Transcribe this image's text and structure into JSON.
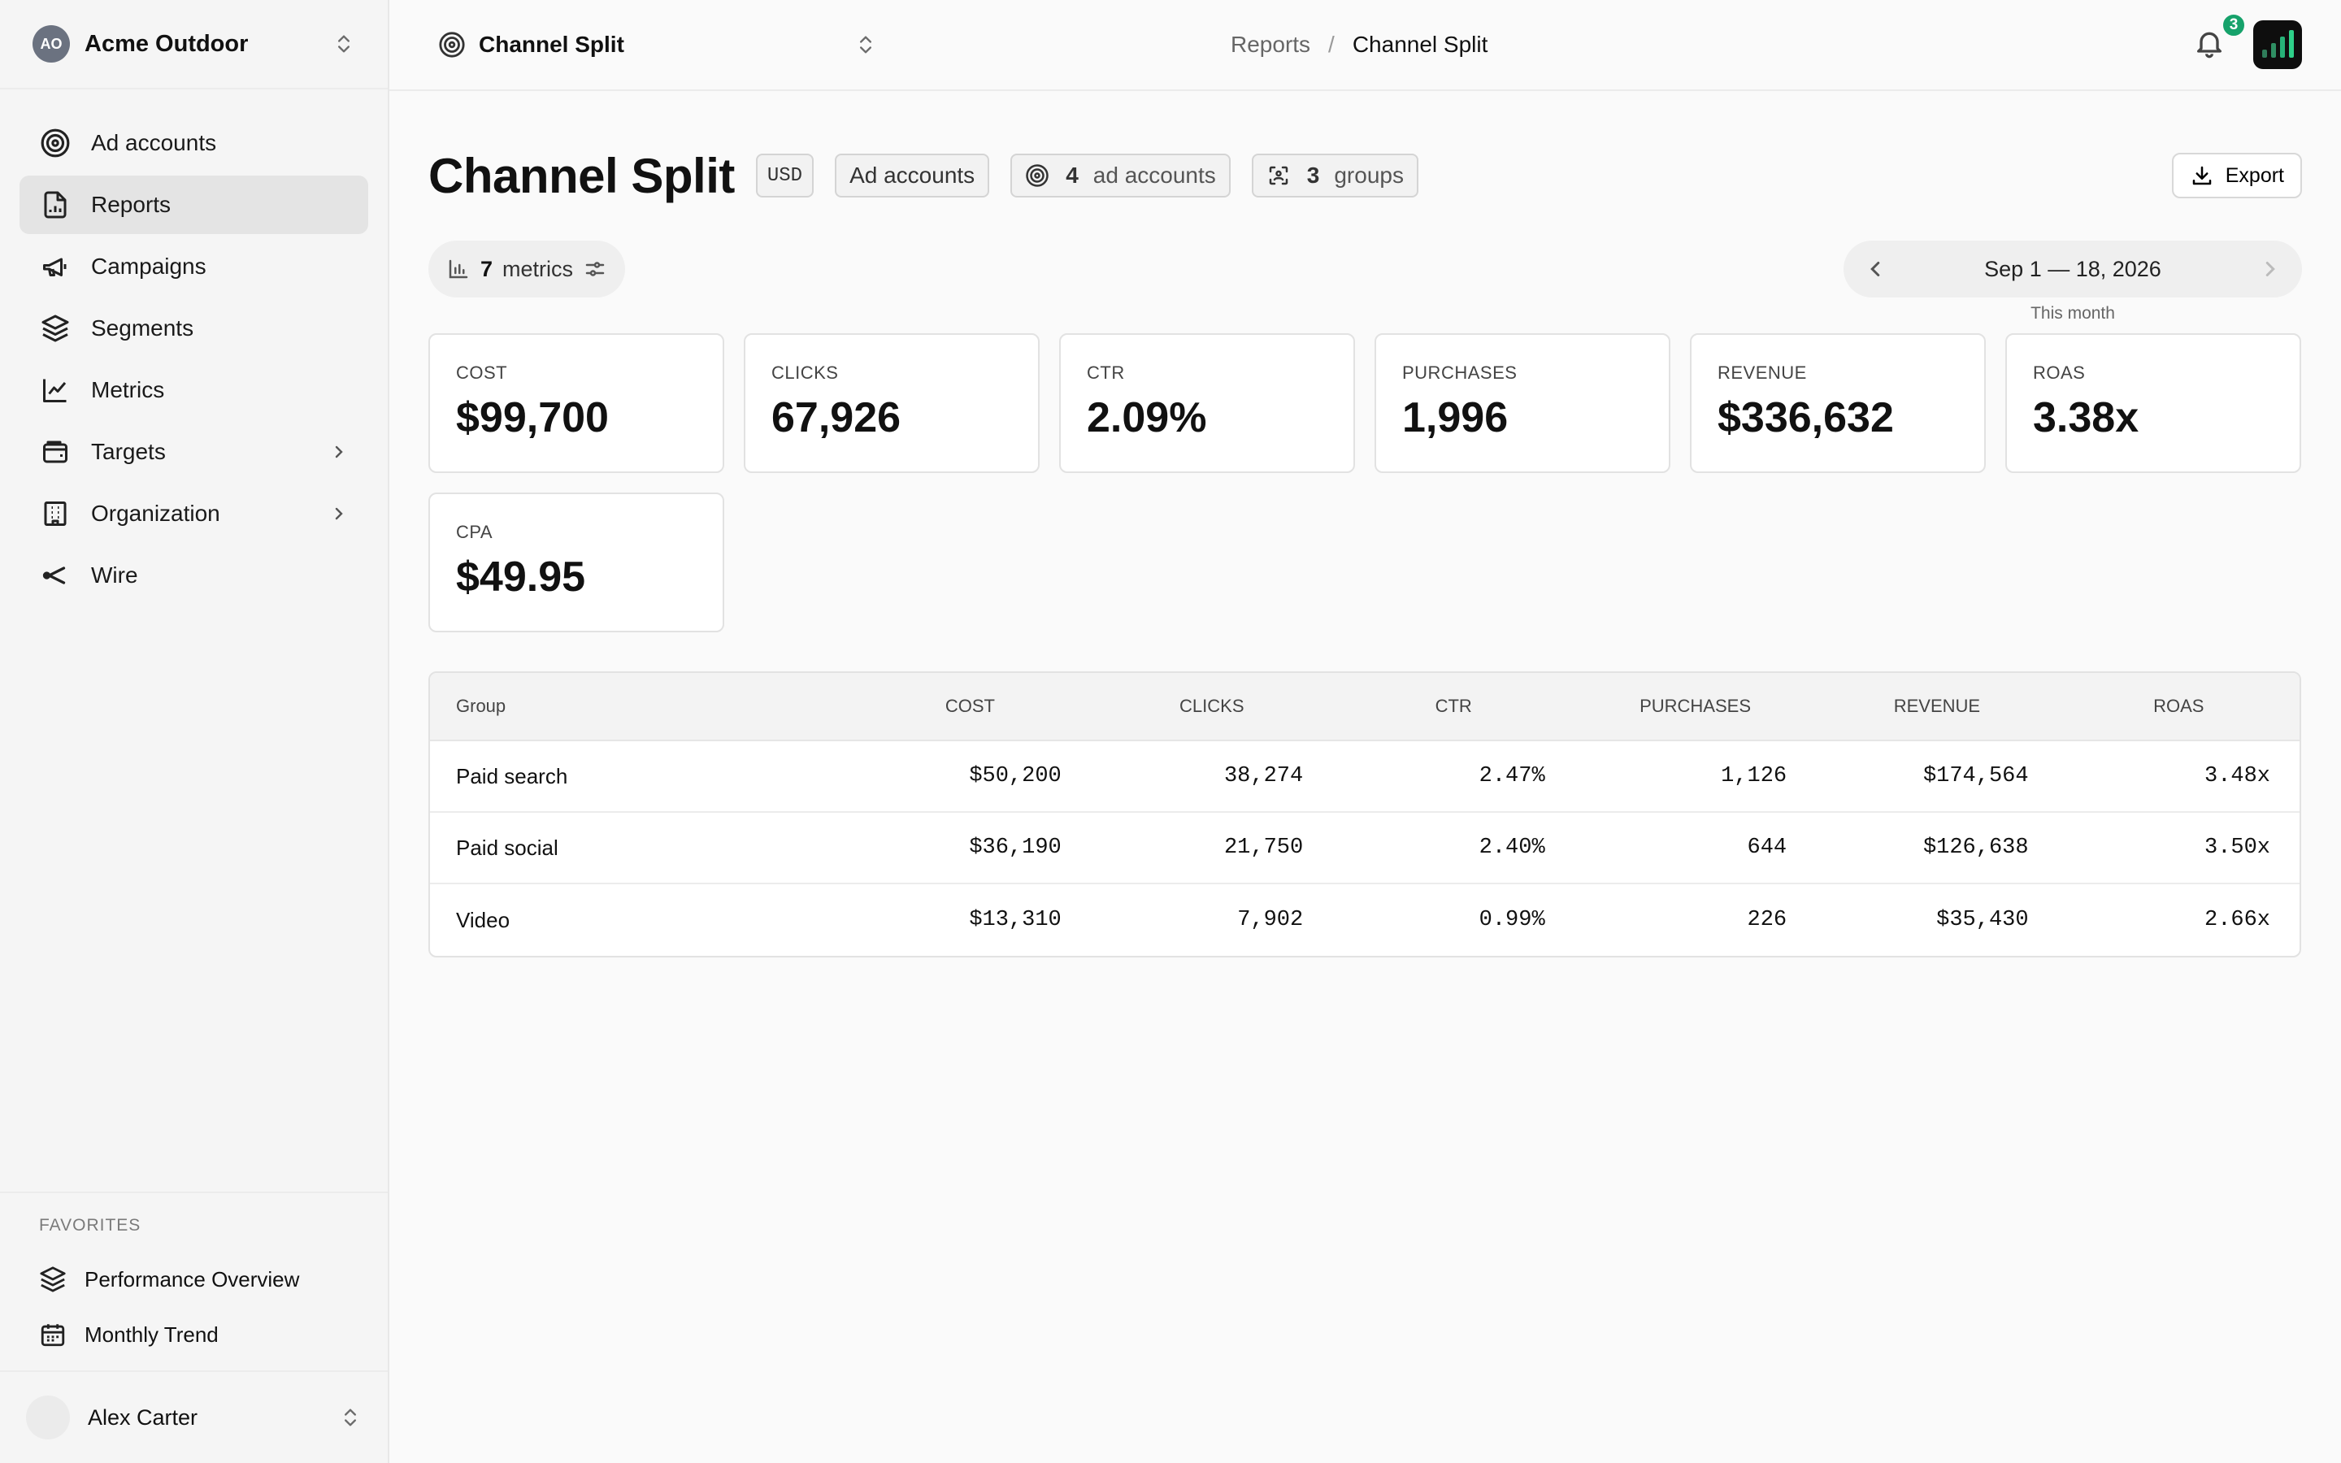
{
  "org": {
    "initials": "AO",
    "name": "Acme Outdoor"
  },
  "nav": [
    {
      "label": "Ad accounts",
      "icon": "target-icon"
    },
    {
      "label": "Reports",
      "icon": "report-icon",
      "active": true
    },
    {
      "label": "Campaigns",
      "icon": "megaphone-icon"
    },
    {
      "label": "Segments",
      "icon": "layers-icon"
    },
    {
      "label": "Metrics",
      "icon": "line-chart-icon"
    },
    {
      "label": "Targets",
      "icon": "wallet-icon",
      "expandable": true
    },
    {
      "label": "Organization",
      "icon": "building-icon",
      "expandable": true
    },
    {
      "label": "Wire",
      "icon": "share-icon"
    }
  ],
  "favorites": {
    "title": "FAVORITES",
    "items": [
      {
        "label": "Performance Overview",
        "icon": "layers-icon"
      },
      {
        "label": "Monthly Trend",
        "icon": "calendar-icon"
      }
    ]
  },
  "user": {
    "name": "Alex Carter"
  },
  "topbar": {
    "report_select": "Channel Split",
    "breadcrumb": [
      "Reports",
      "Channel Split"
    ],
    "breadcrumb_sep": "/",
    "notifications": "3"
  },
  "page": {
    "title": "Channel Split",
    "currency": "USD",
    "ad_accounts_label": "Ad accounts",
    "accounts_count": "4",
    "accounts_label": "ad accounts",
    "groups_count": "3",
    "groups_label": "groups",
    "export_label": "Export",
    "metrics_count": "7",
    "metrics_label": "metrics",
    "date_range": "Sep 1 — 18, 2026",
    "date_sub": "This month"
  },
  "cards": [
    {
      "key": "COST",
      "value": "$99,700"
    },
    {
      "key": "CLICKS",
      "value": "67,926"
    },
    {
      "key": "CTR",
      "value": "2.09%"
    },
    {
      "key": "PURCHASES",
      "value": "1,996"
    },
    {
      "key": "REVENUE",
      "value": "$336,632"
    },
    {
      "key": "ROAS",
      "value": "3.38x"
    },
    {
      "key": "CPA",
      "value": "$49.95"
    }
  ],
  "table": {
    "headers": [
      "Group",
      "COST",
      "CLICKS",
      "CTR",
      "PURCHASES",
      "REVENUE",
      "ROAS"
    ],
    "rows": [
      [
        "Paid search",
        "$50,200",
        "38,274",
        "2.47%",
        "1,126",
        "$174,564",
        "3.48x"
      ],
      [
        "Paid social",
        "$36,190",
        "21,750",
        "2.40%",
        "644",
        "$126,638",
        "3.50x"
      ],
      [
        "Video",
        "$13,310",
        "7,902",
        "0.99%",
        "226",
        "$35,430",
        "2.66x"
      ]
    ]
  },
  "colors": {
    "accent": "#16a26b",
    "active_nav": "#e4e4e4"
  }
}
